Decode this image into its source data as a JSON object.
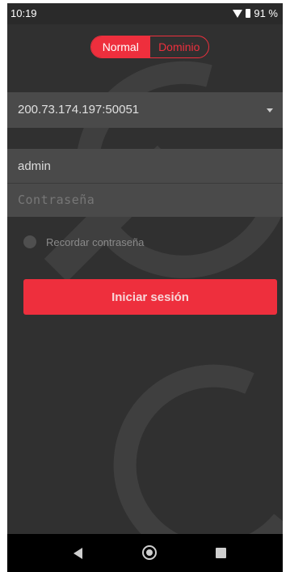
{
  "status_bar": {
    "time": "10:19",
    "battery": "91 %"
  },
  "mode_toggle": {
    "normal_label": "Normal",
    "domain_label": "Dominio",
    "selected": "Normal"
  },
  "server": {
    "value": "200.73.174.197:50051"
  },
  "username": {
    "value": "admin"
  },
  "password": {
    "placeholder": "Contraseña"
  },
  "remember": {
    "label": "Recordar contraseña"
  },
  "login_button": {
    "label": "Iniciar sesión"
  },
  "colors": {
    "accent": "#ee2f3d",
    "background": "#303030",
    "field": "#4a4a4a",
    "nav_bar": "#000000"
  },
  "nav_bar": {
    "icons": [
      "back-icon",
      "home-icon",
      "recent-apps-icon"
    ]
  }
}
